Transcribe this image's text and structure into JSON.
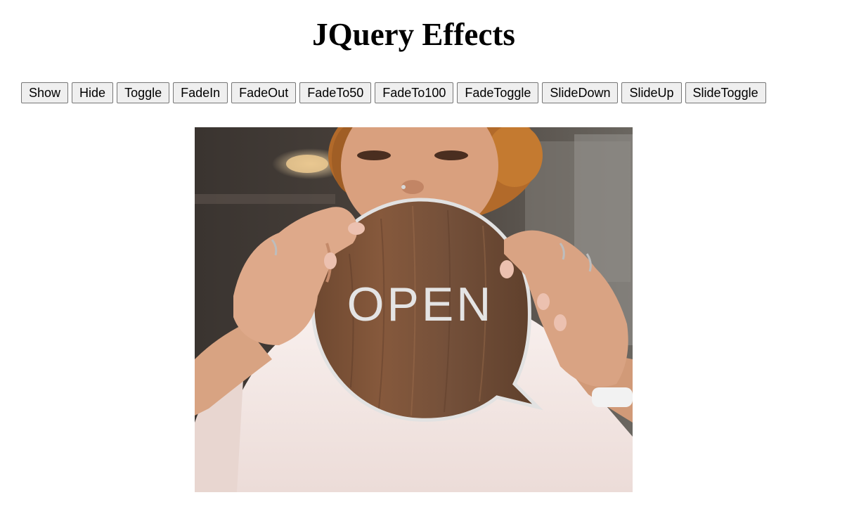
{
  "page": {
    "title": "JQuery Effects"
  },
  "buttons": [
    {
      "label": "Show"
    },
    {
      "label": "Hide"
    },
    {
      "label": "Toggle"
    },
    {
      "label": "FadeIn"
    },
    {
      "label": "FadeOut"
    },
    {
      "label": "FadeTo50"
    },
    {
      "label": "FadeTo100"
    },
    {
      "label": "FadeToggle"
    },
    {
      "label": "SlideDown"
    },
    {
      "label": "SlideUp"
    },
    {
      "label": "SlideToggle"
    }
  ],
  "image": {
    "sign_text": "OPEN"
  },
  "colors": {
    "button_bg": "#efefef",
    "button_border": "#767676",
    "sign_wood": "#7a5238",
    "sign_letters": "#e4e4e4",
    "shirt": "#f6ebe9"
  }
}
